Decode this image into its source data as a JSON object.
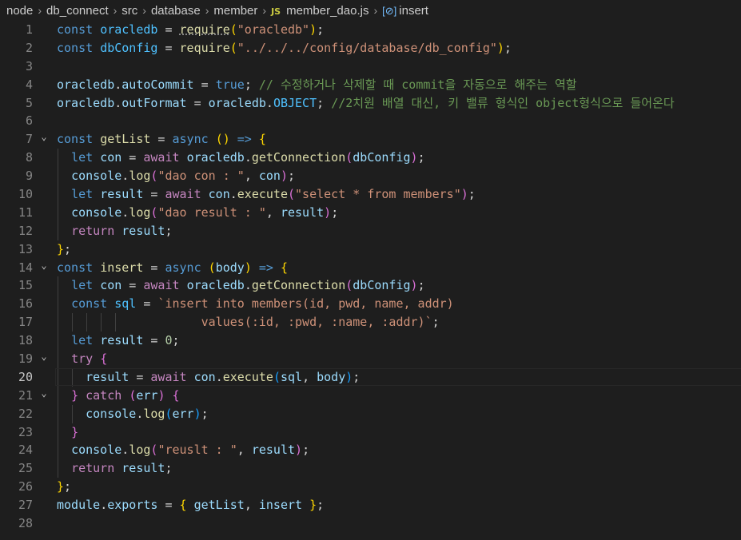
{
  "breadcrumb": {
    "items": [
      "node",
      "db_connect",
      "src",
      "database",
      "member"
    ],
    "js_badge": "JS",
    "file": "member_dao.js",
    "symbol_icon": "[⊘]",
    "symbol": "insert"
  },
  "editor": {
    "active_line": 20,
    "lines": [
      {
        "n": "1",
        "fold": "",
        "code": [
          [
            "k",
            "const "
          ],
          [
            "cn",
            "oracledb"
          ],
          [
            "t",
            " = "
          ],
          [
            "f",
            "require"
          ],
          [
            "b1",
            "("
          ],
          [
            "s",
            "\"oracledb\""
          ],
          [
            "b1",
            ")"
          ],
          [
            "t",
            ";"
          ]
        ]
      },
      {
        "n": "2",
        "fold": "",
        "code": [
          [
            "k",
            "const "
          ],
          [
            "cn",
            "dbConfig"
          ],
          [
            "t",
            " = "
          ],
          [
            "f",
            "require"
          ],
          [
            "b1",
            "("
          ],
          [
            "s",
            "\"../../../config/database/db_config\""
          ],
          [
            "b1",
            ")"
          ],
          [
            "t",
            ";"
          ]
        ]
      },
      {
        "n": "3",
        "fold": "",
        "code": []
      },
      {
        "n": "4",
        "fold": "",
        "code": [
          [
            "v",
            "oracledb"
          ],
          [
            "t",
            "."
          ],
          [
            "v",
            "autoCommit"
          ],
          [
            "t",
            " = "
          ],
          [
            "k",
            "true"
          ],
          [
            "t",
            "; "
          ],
          [
            "cm",
            "// 수정하거나 삭제할 때 commit을 자동으로 해주는 역할"
          ]
        ]
      },
      {
        "n": "5",
        "fold": "",
        "code": [
          [
            "v",
            "oracledb"
          ],
          [
            "t",
            "."
          ],
          [
            "v",
            "outFormat"
          ],
          [
            "t",
            " = "
          ],
          [
            "v",
            "oracledb"
          ],
          [
            "t",
            "."
          ],
          [
            "cn",
            "OBJECT"
          ],
          [
            "t",
            "; "
          ],
          [
            "cm",
            "//2치원 배열 대신, 키 밸류 형식인 object형식으로 들어온다"
          ]
        ]
      },
      {
        "n": "6",
        "fold": "",
        "code": []
      },
      {
        "n": "7",
        "fold": "v",
        "code": [
          [
            "k",
            "const "
          ],
          [
            "f",
            "getList"
          ],
          [
            "t",
            " = "
          ],
          [
            "k",
            "async "
          ],
          [
            "b1",
            "()"
          ],
          [
            "t",
            " "
          ],
          [
            "k",
            "=>"
          ],
          [
            "t",
            " "
          ],
          [
            "b1",
            "{"
          ]
        ]
      },
      {
        "n": "8",
        "fold": "",
        "guides": [
          1
        ],
        "code": [
          [
            "t",
            "  "
          ],
          [
            "k",
            "let "
          ],
          [
            "v",
            "con"
          ],
          [
            "t",
            " = "
          ],
          [
            "c",
            "await "
          ],
          [
            "v",
            "oracledb"
          ],
          [
            "t",
            "."
          ],
          [
            "f",
            "getConnection"
          ],
          [
            "b2",
            "("
          ],
          [
            "v",
            "dbConfig"
          ],
          [
            "b2",
            ")"
          ],
          [
            "t",
            ";"
          ]
        ]
      },
      {
        "n": "9",
        "fold": "",
        "guides": [
          1
        ],
        "code": [
          [
            "t",
            "  "
          ],
          [
            "v",
            "console"
          ],
          [
            "t",
            "."
          ],
          [
            "f",
            "log"
          ],
          [
            "b2",
            "("
          ],
          [
            "s",
            "\"dao con : \""
          ],
          [
            "t",
            ", "
          ],
          [
            "v",
            "con"
          ],
          [
            "b2",
            ")"
          ],
          [
            "t",
            ";"
          ]
        ]
      },
      {
        "n": "10",
        "fold": "",
        "guides": [
          1
        ],
        "code": [
          [
            "t",
            "  "
          ],
          [
            "k",
            "let "
          ],
          [
            "v",
            "result"
          ],
          [
            "t",
            " = "
          ],
          [
            "c",
            "await "
          ],
          [
            "v",
            "con"
          ],
          [
            "t",
            "."
          ],
          [
            "f",
            "execute"
          ],
          [
            "b2",
            "("
          ],
          [
            "s",
            "\"select * from members\""
          ],
          [
            "b2",
            ")"
          ],
          [
            "t",
            ";"
          ]
        ]
      },
      {
        "n": "11",
        "fold": "",
        "guides": [
          1
        ],
        "code": [
          [
            "t",
            "  "
          ],
          [
            "v",
            "console"
          ],
          [
            "t",
            "."
          ],
          [
            "f",
            "log"
          ],
          [
            "b2",
            "("
          ],
          [
            "s",
            "\"dao result : \""
          ],
          [
            "t",
            ", "
          ],
          [
            "v",
            "result"
          ],
          [
            "b2",
            ")"
          ],
          [
            "t",
            ";"
          ]
        ]
      },
      {
        "n": "12",
        "fold": "",
        "guides": [
          1
        ],
        "code": [
          [
            "t",
            "  "
          ],
          [
            "c",
            "return "
          ],
          [
            "v",
            "result"
          ],
          [
            "t",
            ";"
          ]
        ]
      },
      {
        "n": "13",
        "fold": "",
        "code": [
          [
            "b1",
            "}"
          ],
          [
            "t",
            ";"
          ]
        ]
      },
      {
        "n": "14",
        "fold": "v",
        "code": [
          [
            "k",
            "const "
          ],
          [
            "f",
            "insert"
          ],
          [
            "t",
            " = "
          ],
          [
            "k",
            "async "
          ],
          [
            "b1",
            "("
          ],
          [
            "v",
            "body"
          ],
          [
            "b1",
            ")"
          ],
          [
            "t",
            " "
          ],
          [
            "k",
            "=>"
          ],
          [
            "t",
            " "
          ],
          [
            "b1",
            "{"
          ]
        ]
      },
      {
        "n": "15",
        "fold": "",
        "guides": [
          1
        ],
        "code": [
          [
            "t",
            "  "
          ],
          [
            "k",
            "let "
          ],
          [
            "v",
            "con"
          ],
          [
            "t",
            " = "
          ],
          [
            "c",
            "await "
          ],
          [
            "v",
            "oracledb"
          ],
          [
            "t",
            "."
          ],
          [
            "f",
            "getConnection"
          ],
          [
            "b2",
            "("
          ],
          [
            "v",
            "dbConfig"
          ],
          [
            "b2",
            ")"
          ],
          [
            "t",
            ";"
          ]
        ]
      },
      {
        "n": "16",
        "fold": "",
        "guides": [
          1
        ],
        "code": [
          [
            "t",
            "  "
          ],
          [
            "k",
            "const "
          ],
          [
            "cn",
            "sql"
          ],
          [
            "t",
            " = "
          ],
          [
            "s",
            "`insert into members(id, pwd, name, addr)"
          ]
        ]
      },
      {
        "n": "17",
        "fold": "",
        "guides": [
          1,
          3,
          5,
          7,
          9
        ],
        "code": [
          [
            "s",
            "                    values(:id, :pwd, :name, :addr)`"
          ],
          [
            "t",
            ";"
          ]
        ]
      },
      {
        "n": "18",
        "fold": "",
        "guides": [
          1
        ],
        "code": [
          [
            "t",
            "  "
          ],
          [
            "k",
            "let "
          ],
          [
            "v",
            "result"
          ],
          [
            "t",
            " = "
          ],
          [
            "n",
            "0"
          ],
          [
            "t",
            ";"
          ]
        ]
      },
      {
        "n": "19",
        "fold": "v",
        "guides": [
          1
        ],
        "code": [
          [
            "t",
            "  "
          ],
          [
            "c",
            "try "
          ],
          [
            "b2",
            "{"
          ]
        ]
      },
      {
        "n": "20",
        "fold": "",
        "guides": [
          1,
          3
        ],
        "code": [
          [
            "t",
            "    "
          ],
          [
            "v",
            "result"
          ],
          [
            "t",
            " = "
          ],
          [
            "c",
            "await "
          ],
          [
            "v",
            "con"
          ],
          [
            "t",
            "."
          ],
          [
            "f",
            "execute"
          ],
          [
            "b3",
            "("
          ],
          [
            "v",
            "sql"
          ],
          [
            "t",
            ", "
          ],
          [
            "v",
            "body"
          ],
          [
            "b3",
            ")"
          ],
          [
            "t",
            ";"
          ]
        ]
      },
      {
        "n": "21",
        "fold": "v",
        "guides": [
          1
        ],
        "code": [
          [
            "t",
            "  "
          ],
          [
            "b2",
            "}"
          ],
          [
            "t",
            " "
          ],
          [
            "c",
            "catch "
          ],
          [
            "b2",
            "("
          ],
          [
            "v",
            "err"
          ],
          [
            "b2",
            ")"
          ],
          [
            "t",
            " "
          ],
          [
            "b2",
            "{"
          ]
        ]
      },
      {
        "n": "22",
        "fold": "",
        "guides": [
          1,
          3
        ],
        "code": [
          [
            "t",
            "    "
          ],
          [
            "v",
            "console"
          ],
          [
            "t",
            "."
          ],
          [
            "f",
            "log"
          ],
          [
            "b3",
            "("
          ],
          [
            "v",
            "err"
          ],
          [
            "b3",
            ")"
          ],
          [
            "t",
            ";"
          ]
        ]
      },
      {
        "n": "23",
        "fold": "",
        "guides": [
          1
        ],
        "code": [
          [
            "t",
            "  "
          ],
          [
            "b2",
            "}"
          ]
        ]
      },
      {
        "n": "24",
        "fold": "",
        "guides": [
          1
        ],
        "code": [
          [
            "t",
            "  "
          ],
          [
            "v",
            "console"
          ],
          [
            "t",
            "."
          ],
          [
            "f",
            "log"
          ],
          [
            "b2",
            "("
          ],
          [
            "s",
            "\"reuslt : \""
          ],
          [
            "t",
            ", "
          ],
          [
            "v",
            "result"
          ],
          [
            "b2",
            ")"
          ],
          [
            "t",
            ";"
          ]
        ]
      },
      {
        "n": "25",
        "fold": "",
        "guides": [
          1
        ],
        "code": [
          [
            "t",
            "  "
          ],
          [
            "c",
            "return "
          ],
          [
            "v",
            "result"
          ],
          [
            "t",
            ";"
          ]
        ]
      },
      {
        "n": "26",
        "fold": "",
        "code": [
          [
            "b1",
            "}"
          ],
          [
            "t",
            ";"
          ]
        ]
      },
      {
        "n": "27",
        "fold": "",
        "code": [
          [
            "v",
            "module"
          ],
          [
            "t",
            "."
          ],
          [
            "v",
            "exports"
          ],
          [
            "t",
            " = "
          ],
          [
            "b1",
            "{"
          ],
          [
            "t",
            " "
          ],
          [
            "v",
            "getList"
          ],
          [
            "t",
            ", "
          ],
          [
            "v",
            "insert"
          ],
          [
            "t",
            " "
          ],
          [
            "b1",
            "}"
          ],
          [
            "t",
            ";"
          ]
        ]
      },
      {
        "n": "28",
        "fold": "",
        "code": []
      }
    ]
  }
}
